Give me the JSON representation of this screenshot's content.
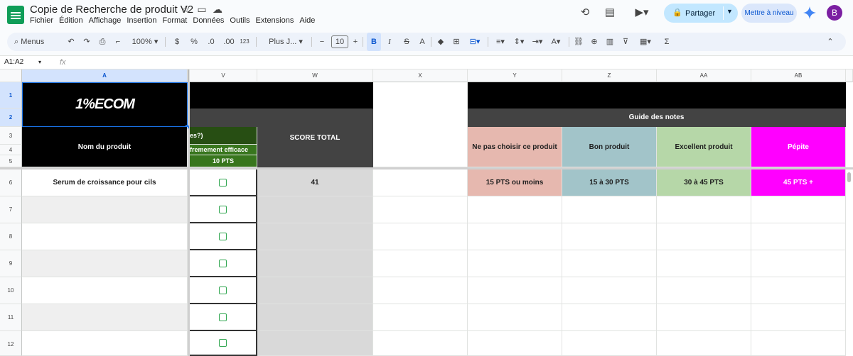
{
  "header": {
    "title": "Copie de Recherche de produit V2",
    "menu": [
      "Fichier",
      "Édition",
      "Affichage",
      "Insertion",
      "Format",
      "Données",
      "Outils",
      "Extensions",
      "Aide"
    ],
    "share_label": "Partager",
    "upgrade_label": "Mettre à niveau",
    "avatar_letter": "B"
  },
  "toolbar": {
    "search_label": "Menus",
    "zoom": "100%",
    "currency": "$",
    "percent": "%",
    "dec_decrease": ".0",
    "dec_increase": ".00",
    "number_format": "123",
    "font": "Plus J...",
    "font_size": "10",
    "bold": "B",
    "italic": "I",
    "strike": "S",
    "text_color": "A"
  },
  "formula": {
    "name_box": "A1:A2",
    "fx": "fx"
  },
  "columns": [
    "A",
    "V",
    "W",
    "X",
    "Y",
    "Z",
    "AA",
    "AB"
  ],
  "rows": [
    "1",
    "2",
    "3",
    "4",
    "5",
    "6",
    "7",
    "8",
    "9",
    "10",
    "11",
    "12"
  ],
  "sheet": {
    "logo_text": "1%ECOM",
    "product_header": "Nom du produit",
    "partial_header_1": "es?)",
    "partial_header_2": "fremement efficace",
    "pts_label": "10 PTS",
    "score_header": "SCORE TOTAL",
    "guide_title": "Guide des notes",
    "guide": [
      {
        "label": "Ne pas choisir ce produit",
        "range": "15 PTS ou moins",
        "color": "#e6b8af"
      },
      {
        "label": "Bon produit",
        "range": "15 à 30 PTS",
        "color": "#a2c4c9"
      },
      {
        "label": "Excellent produit",
        "range": "30 à 45 PTS",
        "color": "#b6d7a8"
      },
      {
        "label": "Pépite",
        "range": "45 PTS +",
        "color": "#ff00ff"
      }
    ],
    "product_name": "Serum de croissance pour cils",
    "score": "41"
  },
  "colors": {
    "accent": "#0b57d0",
    "header_black": "#000000",
    "dark_gray": "#434343",
    "green_dark": "#38761d",
    "score_gray": "#d9d9d9"
  }
}
